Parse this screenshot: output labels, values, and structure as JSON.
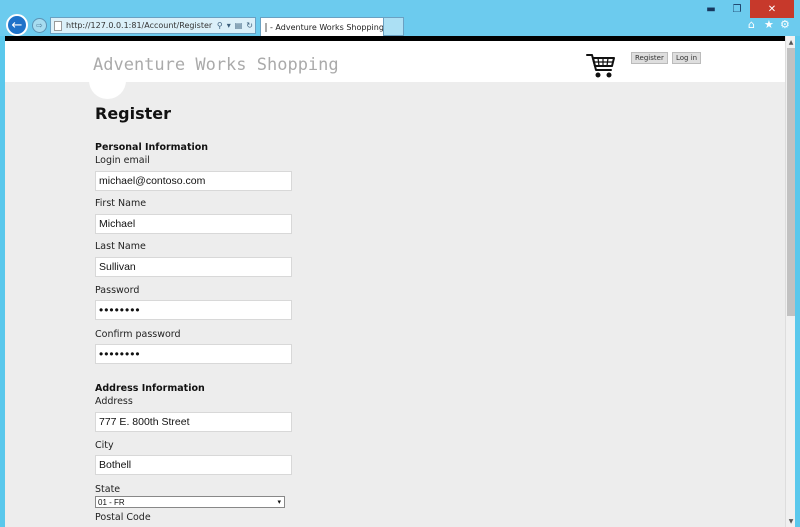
{
  "browser": {
    "address": "http://127.0.0.1:81/Account/Register",
    "tab_title": "- Adventure Works Shopping",
    "tab_close": "×",
    "minimize": "▬",
    "restore": "❐",
    "close": "✕",
    "back_icon": "←",
    "forward_icon": "⇨",
    "search_icon": "⚲",
    "dropdown_icon": "▾",
    "compat_icon": "▤",
    "refresh_icon": "↻",
    "home_icon": "⌂",
    "favorites_icon": "★",
    "settings_icon": "⚙"
  },
  "header": {
    "site_title": "Adventure Works Shopping",
    "register_link": "Register",
    "login_link": "Log in"
  },
  "form": {
    "title": "Register",
    "personal_section": "Personal Information",
    "login_email_label": "Login email",
    "login_email_value": "michael@contoso.com",
    "first_name_label": "First Name",
    "first_name_value": "Michael",
    "last_name_label": "Last Name",
    "last_name_value": "Sullivan",
    "password_label": "Password",
    "password_value": "••••••••",
    "confirm_password_label": "Confirm password",
    "confirm_password_value": "••••••••",
    "address_section": "Address Information",
    "address_label": "Address",
    "address_value": "777 E. 800th Street",
    "city_label": "City",
    "city_value": "Bothell",
    "state_label": "State",
    "state_value": "01 - FR",
    "postal_code_label": "Postal Code"
  },
  "scrollbar": {
    "up_icon": "▲",
    "down_icon": "▼"
  }
}
